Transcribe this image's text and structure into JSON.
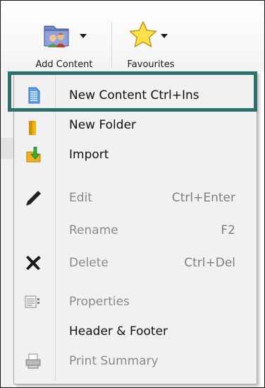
{
  "toolbar": {
    "add_content_label": "Add Content",
    "favourites_label": "Favourites"
  },
  "menu": {
    "items": [
      {
        "label": "New Content Ctrl+Ins",
        "shortcut": "",
        "icon": "document-icon",
        "enabled": true
      },
      {
        "label": "New Folder",
        "shortcut": "",
        "icon": "folder-icon",
        "enabled": true
      },
      {
        "label": "Import",
        "shortcut": "",
        "icon": "import-icon",
        "enabled": true
      },
      {
        "label": "Edit",
        "shortcut": "Ctrl+Enter",
        "icon": "pencil-icon",
        "enabled": false
      },
      {
        "label": "Rename",
        "shortcut": "F2",
        "icon": "",
        "enabled": false
      },
      {
        "label": "Delete",
        "shortcut": "Ctrl+Del",
        "icon": "delete-x-icon",
        "enabled": false
      },
      {
        "label": "Properties",
        "shortcut": "",
        "icon": "properties-icon",
        "enabled": false
      },
      {
        "label": "Header & Footer",
        "shortcut": "",
        "icon": "",
        "enabled": true
      },
      {
        "label": "Print Summary",
        "shortcut": "",
        "icon": "printer-icon",
        "enabled": false
      }
    ]
  },
  "colors": {
    "highlight_border": "#2f6f6e",
    "menu_background": "#f1f1f1",
    "disabled_text": "#8a8a8a"
  }
}
